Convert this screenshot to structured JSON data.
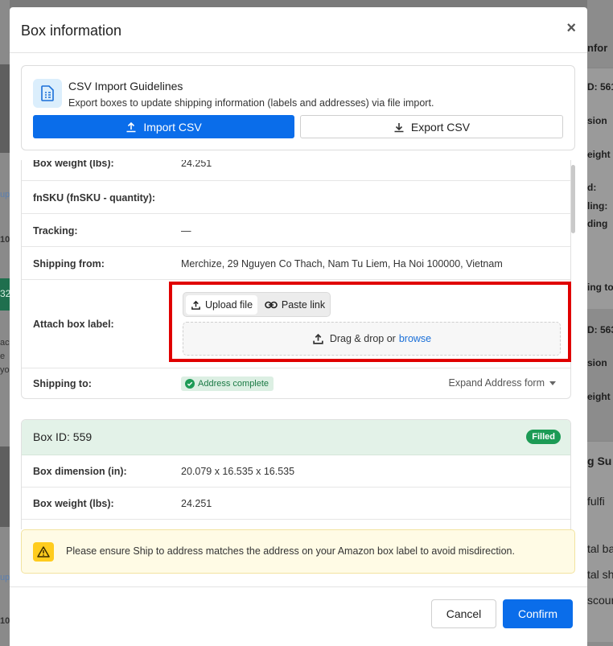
{
  "background": {
    "left_texts": [
      "up",
      "10",
      "32",
      "ac",
      "e",
      "yo",
      "up",
      "10"
    ],
    "right_texts": [
      "nfor",
      "D: 561",
      "sion",
      "eight",
      "d:",
      "ling:",
      "ding",
      "ing to",
      "D: 563",
      "sion",
      "eight",
      "g Su",
      "fulfi",
      "tal ba",
      "tal sh",
      "scoun"
    ]
  },
  "modal": {
    "title": "Box information",
    "close_label": "×"
  },
  "guidelines": {
    "title": "CSV Import Guidelines",
    "description": "Export boxes to update shipping information (labels and addresses) via file import.",
    "import_label": "Import CSV",
    "export_label": "Export CSV"
  },
  "box1": {
    "rows": [
      {
        "label": "Box weight (lbs):",
        "value": "24.251"
      },
      {
        "label": "fnSKU (fnSKU - quantity):",
        "value": ""
      },
      {
        "label": "Tracking:",
        "value": "—"
      },
      {
        "label": "Shipping from:",
        "value": "Merchize, 29 Nguyen Co Thach, Nam Tu Liem, Ha Noi 100000, Vietnam"
      }
    ],
    "attach_label": "Attach box label:",
    "upload_tab": "Upload file",
    "paste_tab": "Paste link",
    "drop_text": "Drag & drop or",
    "browse_text": "browse",
    "shipping_to_label": "Shipping to:",
    "address_badge": "Address complete",
    "expand_label": "Expand Address form"
  },
  "box2": {
    "title": "Box ID: 559",
    "status": "Filled",
    "rows": [
      {
        "label": "Box dimension (in):",
        "value": "20.079 x 16.535 x 16.535"
      },
      {
        "label": "Box weight (lbs):",
        "value": "24.251"
      }
    ]
  },
  "warning": {
    "text": "Please ensure Ship to address matches the address on your Amazon box label to avoid misdirection."
  },
  "footer": {
    "cancel_label": "Cancel",
    "confirm_label": "Confirm"
  },
  "colors": {
    "primary": "#0a6dea",
    "highlight_frame": "#e00000",
    "filled_badge": "#1c9b55",
    "warning_bg": "#fffbe5"
  }
}
